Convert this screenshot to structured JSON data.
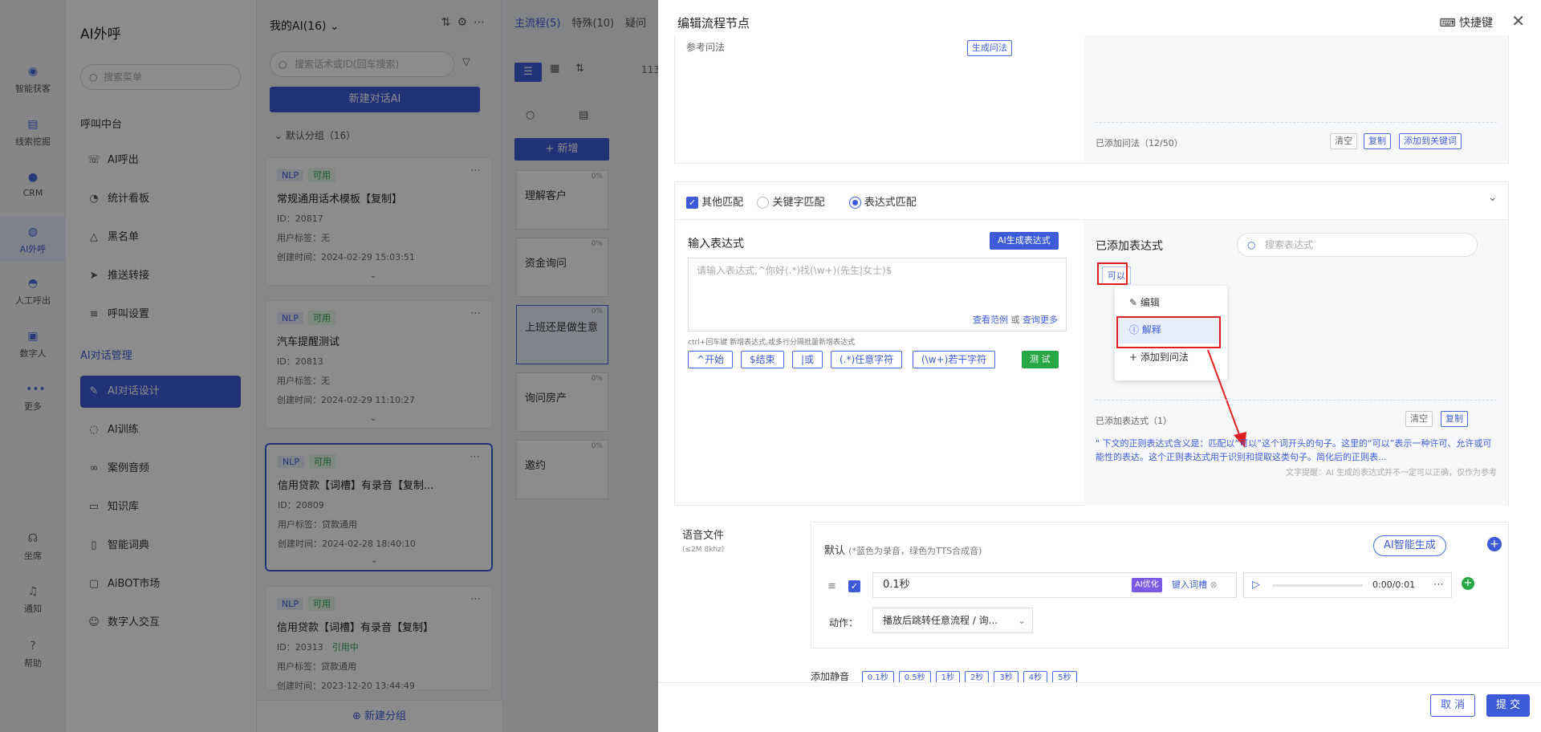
{
  "rail": [
    {
      "label": "智能获客",
      "icon": "target-icon"
    },
    {
      "label": "线索挖掘",
      "icon": "clipboard-icon"
    },
    {
      "label": "CRM",
      "icon": "crm-icon"
    },
    {
      "label": "AI外呼",
      "icon": "robot-icon"
    },
    {
      "label": "人工呼出",
      "icon": "headset-icon"
    },
    {
      "label": "数字人",
      "icon": "video-icon"
    },
    {
      "label": "更多",
      "icon": "more-icon"
    },
    {
      "label": "坐席",
      "icon": "agent-icon"
    },
    {
      "label": "通知",
      "icon": "bell-icon"
    },
    {
      "label": "帮助",
      "icon": "help-icon"
    }
  ],
  "menu": {
    "title": "AI外呼",
    "search_placeholder": "搜索菜单",
    "section1": "呼叫中台",
    "items1": [
      "AI呼出",
      "统计看板",
      "黑名单",
      "推送转接",
      "呼叫设置"
    ],
    "section2": "AI对话管理",
    "items2": [
      "AI对话设计",
      "AI训练",
      "案例音频",
      "知识库",
      "智能词典",
      "AiBOT市场",
      "数字人交互"
    ]
  },
  "list": {
    "header": "我的AI(16)",
    "search_placeholder": "搜索话术或ID(回车搜索)",
    "new_button": "新建对话AI",
    "group": "默认分组（16）",
    "cards": [
      {
        "tag1": "NLP",
        "tag2": "可用",
        "name": "常规通用话术模板【复制】",
        "id": "ID：20817",
        "label": "用户标签：无",
        "time": "创建时间：2024-02-29 15:03:51"
      },
      {
        "tag1": "NLP",
        "tag2": "可用",
        "name": "汽车提醒测试",
        "id": "ID：20813",
        "label": "用户标签：无",
        "time": "创建时间：2024-02-29 11:10:27"
      },
      {
        "tag1": "NLP",
        "tag2": "可用",
        "name": "信用贷款【词槽】有录音【复制...",
        "id": "ID：20809",
        "label": "用户标签：贷款通用",
        "time": "创建时间：2024-02-28 18:40:10"
      },
      {
        "tag1": "NLP",
        "tag2": "可用",
        "name": "信用贷款【词槽】有录音【复制】",
        "id": "ID：20313",
        "ref": "引用中",
        "label": "用户标签：贷款通用",
        "time": "创建时间：2023-12-20 13:44:49"
      }
    ],
    "add_group": "新建分组"
  },
  "flow": {
    "tabs": [
      "主流程(5)",
      "特殊(10)",
      "疑问"
    ],
    "count": "113",
    "add_button": "新增",
    "nodes": [
      "理解客户",
      "资金询问",
      "上班还是做生意",
      "询问房产",
      "邀约"
    ],
    "pct": "0%"
  },
  "drawer": {
    "title": "编辑流程节点",
    "shortcut": "快捷键",
    "ref_label": "参考问法",
    "gen_button": "生成问法",
    "added_count": "已添加问法（12/50）",
    "btn_clear": "清空",
    "btn_copy": "复制",
    "btn_add_kw": "添加到关键词",
    "match_other": "其他匹配",
    "match_keyword": "关键字匹配",
    "match_regex": "表达式匹配",
    "input_title": "输入表达式",
    "ai_gen": "AI生成表达式",
    "input_placeholder": "请输入表达式,^你好(.*)找(\\w+)(先生|女士)$",
    "view_example": "查看范例",
    "or": "或",
    "query_more": "查询更多",
    "hint": "ctrl+回车键 新增表达式,或多行分隔批量新增表达式",
    "chips": [
      "^开始",
      "$结束",
      "|或",
      "(.*)任意字符",
      "(\\w+)若干字符"
    ],
    "test": "测 试",
    "added_title": "已添加表达式",
    "search_placeholder": "搜索表达式",
    "expr_tag": "可以",
    "ctx_menu": [
      "编辑",
      "解释",
      "添加到问法"
    ],
    "added_expr_count": "已添加表达式（1）",
    "explain": "\" 下文的正则表达式含义是：匹配以“可以”这个词开头的句子。这里的“可以”表示一种许可、允许或可能性的表达。这个正则表达式用于识别和提取这类句子。简化后的正则表...",
    "notice": "文字提醒：AI 生成的表达式并不一定可以正确，仅作为参考",
    "voice_label": "语音文件",
    "voice_sub": "(≤2M 8khz)",
    "default_label": "默认",
    "default_note": "(*蓝色为录音，绿色为TTS合成音)",
    "ai_smart": "AI智能生成",
    "audio_text": "0.1秒",
    "ai_opt": "AI优化",
    "key_slot": "键入词槽",
    "time": "0:00/0:01",
    "action_label": "动作：",
    "action_value": "播放后跳转任意流程 / 询...",
    "silence_label": "添加静音",
    "silence": [
      "0.1秒",
      "0.5秒",
      "1秒",
      "2秒",
      "3秒",
      "4秒",
      "5秒"
    ],
    "cancel": "取 消",
    "submit": "提 交"
  }
}
